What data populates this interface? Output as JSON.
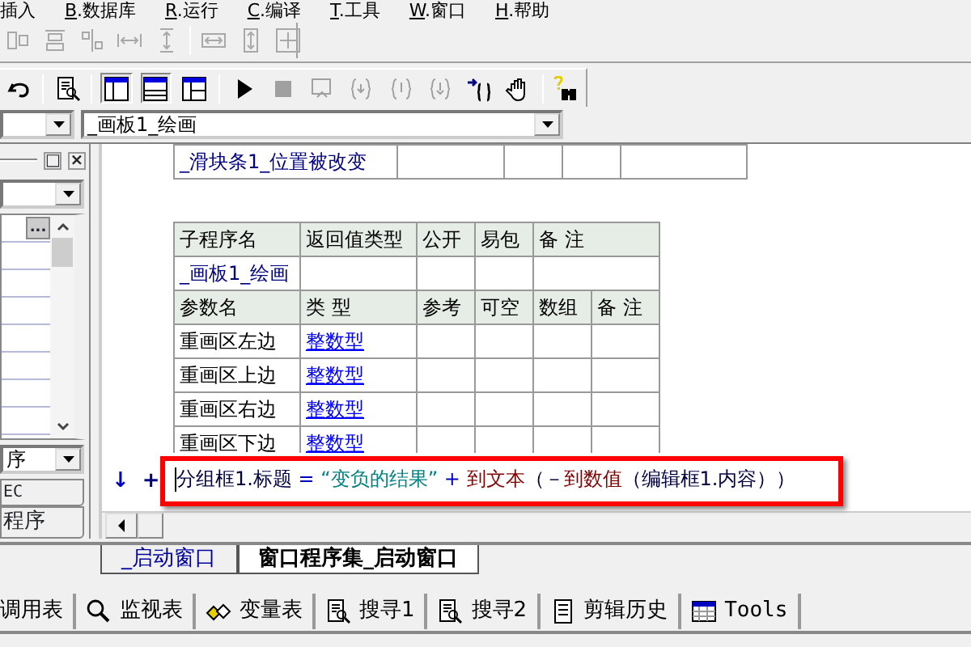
{
  "menu": [
    {
      "label": "插入",
      "accelerator": false
    },
    {
      "label": "B.数据库",
      "accelerator": true
    },
    {
      "label": "R.运行",
      "accelerator": true
    },
    {
      "label": "C.编译",
      "accelerator": true
    },
    {
      "label": "T.工具",
      "accelerator": true
    },
    {
      "label": "W.窗口",
      "accelerator": true
    },
    {
      "label": "H.帮助",
      "accelerator": true
    }
  ],
  "align_toolbar": [
    {
      "disabled": true
    },
    {
      "disabled": true
    },
    {
      "disabled": true
    },
    {
      "disabled": true
    },
    {
      "disabled": true
    },
    {
      "disabled": true
    },
    {
      "disabled": true
    },
    {
      "disabled": true
    }
  ],
  "main_toolbar": [
    {
      "disabled": false,
      "pressed": false
    },
    {
      "disabled": false,
      "pressed": false
    },
    {
      "disabled": false,
      "pressed": true
    },
    {
      "disabled": false,
      "pressed": true
    },
    {
      "disabled": false,
      "pressed": false
    },
    {
      "disabled": false,
      "pressed": false
    },
    {
      "disabled": true,
      "pressed": false
    },
    {
      "disabled": true,
      "pressed": false
    },
    {
      "disabled": true,
      "pressed": false
    },
    {
      "disabled": true,
      "pressed": false
    },
    {
      "disabled": true,
      "pressed": false
    },
    {
      "disabled": false,
      "pressed": false
    },
    {
      "disabled": false,
      "pressed": false
    },
    {
      "disabled": false,
      "pressed": false
    }
  ],
  "subroutine_combo": {
    "value": "_画板1_绘画"
  },
  "left_panel": {
    "restore_button": "□",
    "close_button": "×",
    "ellipsis_button": "...",
    "sort_combo": "序",
    "tabs": [
      {
        "label": "EC"
      },
      {
        "label": "程序"
      }
    ]
  },
  "event_table": {
    "name": "_滑块条1_位置被改变"
  },
  "sub_table": {
    "columns": [
      "子程序名",
      "返回值类型",
      "公开",
      "易包",
      "备 注"
    ],
    "name": "_画板1_绘画",
    "param_columns": [
      "参数名",
      "类 型",
      "参考",
      "可空",
      "数组",
      "备 注"
    ],
    "params": [
      {
        "name": "重画区左边",
        "type": "整数型"
      },
      {
        "name": "重画区上边",
        "type": "整数型"
      },
      {
        "name": "重画区右边",
        "type": "整数型"
      },
      {
        "name": "重画区下边",
        "type": "整数型"
      }
    ]
  },
  "code_line": {
    "marks": [
      "↓",
      "+"
    ],
    "highlighted": true,
    "tokens": [
      {
        "text": "分组框1.标题 ",
        "kind": "plain"
      },
      {
        "text": "= ",
        "kind": "operator"
      },
      {
        "text": "“变负的结果” ",
        "kind": "string"
      },
      {
        "text": "+ ",
        "kind": "operator"
      },
      {
        "text": "到文本",
        "kind": "command"
      },
      {
        "text": "（－",
        "kind": "plain"
      },
      {
        "text": "到数值",
        "kind": "command"
      },
      {
        "text": "（编辑框1.内容））",
        "kind": "plain"
      }
    ]
  },
  "file_tabs": [
    {
      "label": "_启动窗口",
      "selected": false
    },
    {
      "label": "窗口程序集_启动窗口",
      "selected": true
    }
  ],
  "bottom_tabs": [
    {
      "label": "调用表"
    },
    {
      "label": "监视表"
    },
    {
      "label": "变量表"
    },
    {
      "label": "搜寻1"
    },
    {
      "label": "搜寻2"
    },
    {
      "label": "剪辑历史"
    },
    {
      "label": "Tools"
    }
  ]
}
